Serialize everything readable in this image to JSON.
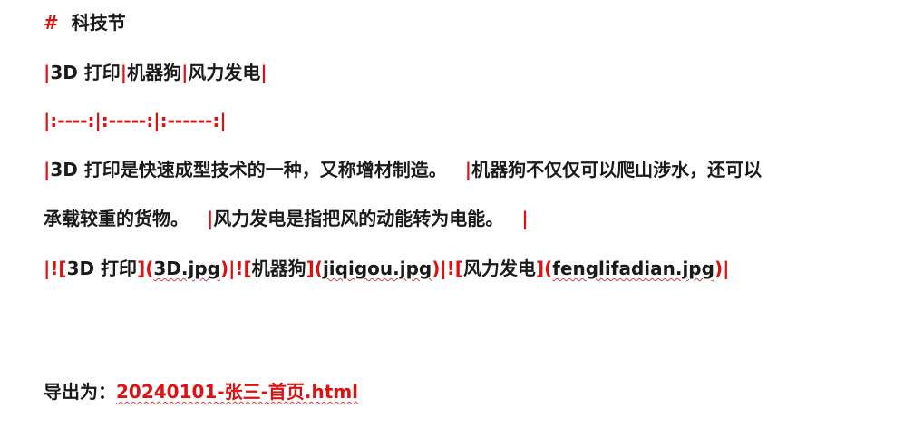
{
  "heading": {
    "hash": "#",
    "title": "科技节"
  },
  "table_header": {
    "pipe": "|",
    "cells": [
      "3D 打印",
      "机器狗",
      "风力发电"
    ]
  },
  "table_align": "|:----:|:-----:|:------:|",
  "table_row": {
    "cell1": "3D 打印是快速成型技术的一种，又称增材制造。",
    "cell2_line1": "机器狗不仅仅可以爬山涉水，还可以",
    "cell2_line2": "承载较重的货物。",
    "cell3": "风力发电是指把风的动能转为电能。"
  },
  "image_row": {
    "images": [
      {
        "alt": "3D 打印",
        "file": "3D.jpg"
      },
      {
        "alt": "机器狗",
        "file": "jiqigou.jpg"
      },
      {
        "alt": "风力发电",
        "file": "fenglifadian.jpg"
      }
    ]
  },
  "export": {
    "label": "导出为：",
    "filename": "20240101-张三-首页.html"
  }
}
